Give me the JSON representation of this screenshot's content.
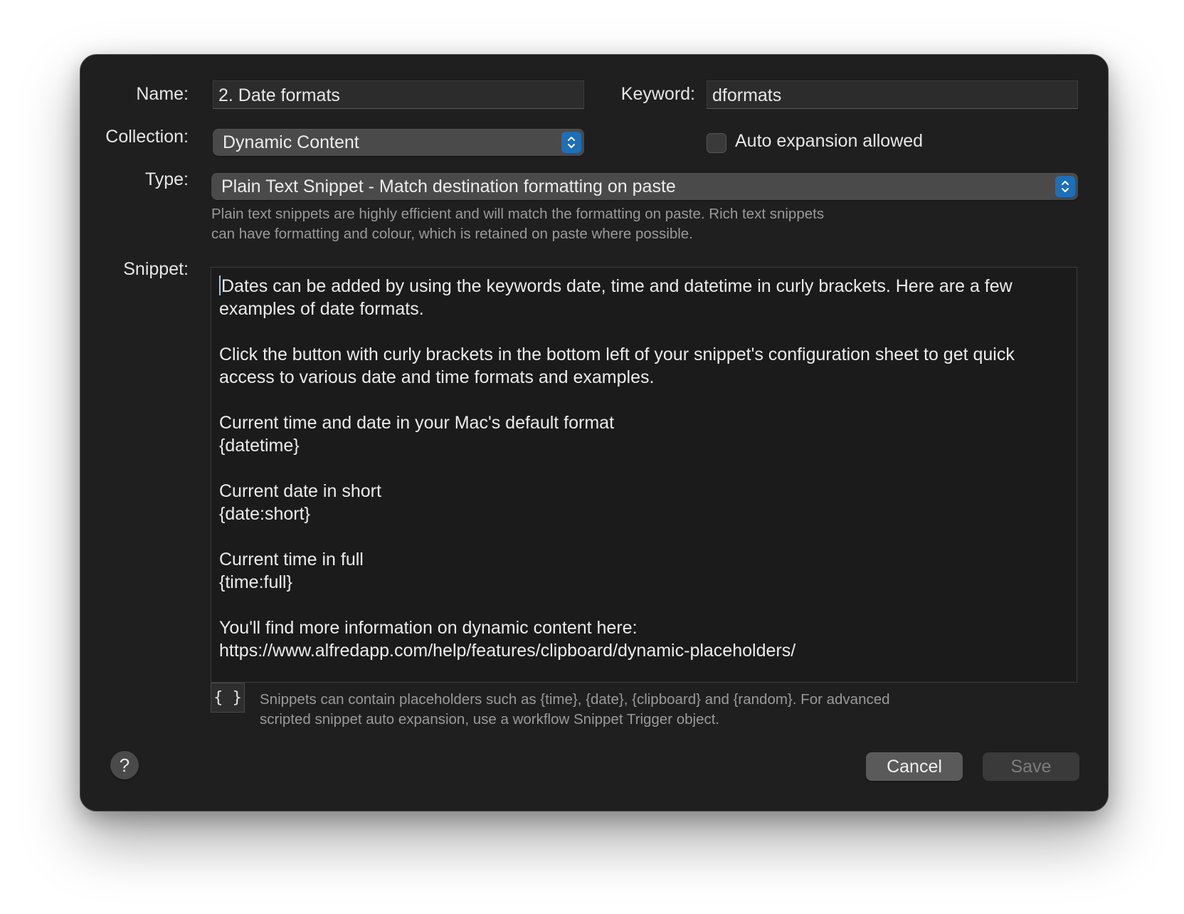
{
  "form": {
    "name_label": "Name:",
    "name_value": "2. Date formats",
    "keyword_label": "Keyword:",
    "keyword_value": "dformats",
    "collection_label": "Collection:",
    "collection_value": "Dynamic Content",
    "auto_expansion_label": "Auto expansion allowed",
    "auto_expansion_checked": false,
    "type_label": "Type:",
    "type_value": "Plain Text Snippet - Match destination formatting on paste",
    "type_hint_line1": "Plain text snippets are highly efficient and will match the formatting on paste. Rich text snippets",
    "type_hint_line2": "can have formatting and colour, which is retained on paste where possible.",
    "snippet_label": "Snippet:"
  },
  "snippet": {
    "paragraphs": [
      "Dates can be added by using the keywords date, time and datetime in curly brackets. Here are a few examples of date formats.",
      "Click the button with curly brackets in the bottom left of your snippet's configuration sheet to get quick access to various date and time formats and examples.",
      "Current time and date in your Mac's default format\n{datetime}",
      "Current date in short\n{date:short}",
      "Current time in full\n{time:full}",
      "You'll find more information on dynamic content here:\nhttps://www.alfredapp.com/help/features/clipboard/dynamic-placeholders/"
    ]
  },
  "placeholder_hint": {
    "button_label": "{ }",
    "line1": "Snippets can contain placeholders such as {time}, {date}, {clipboard} and {random}. For advanced",
    "line2": "scripted snippet auto expansion, use a workflow Snippet Trigger object."
  },
  "footer": {
    "help_label": "?",
    "cancel_label": "Cancel",
    "save_label": "Save"
  },
  "colors": {
    "window_bg": "#1f1f1f",
    "accent": "#1d6fb8",
    "hint_text": "#9a9a9a"
  }
}
